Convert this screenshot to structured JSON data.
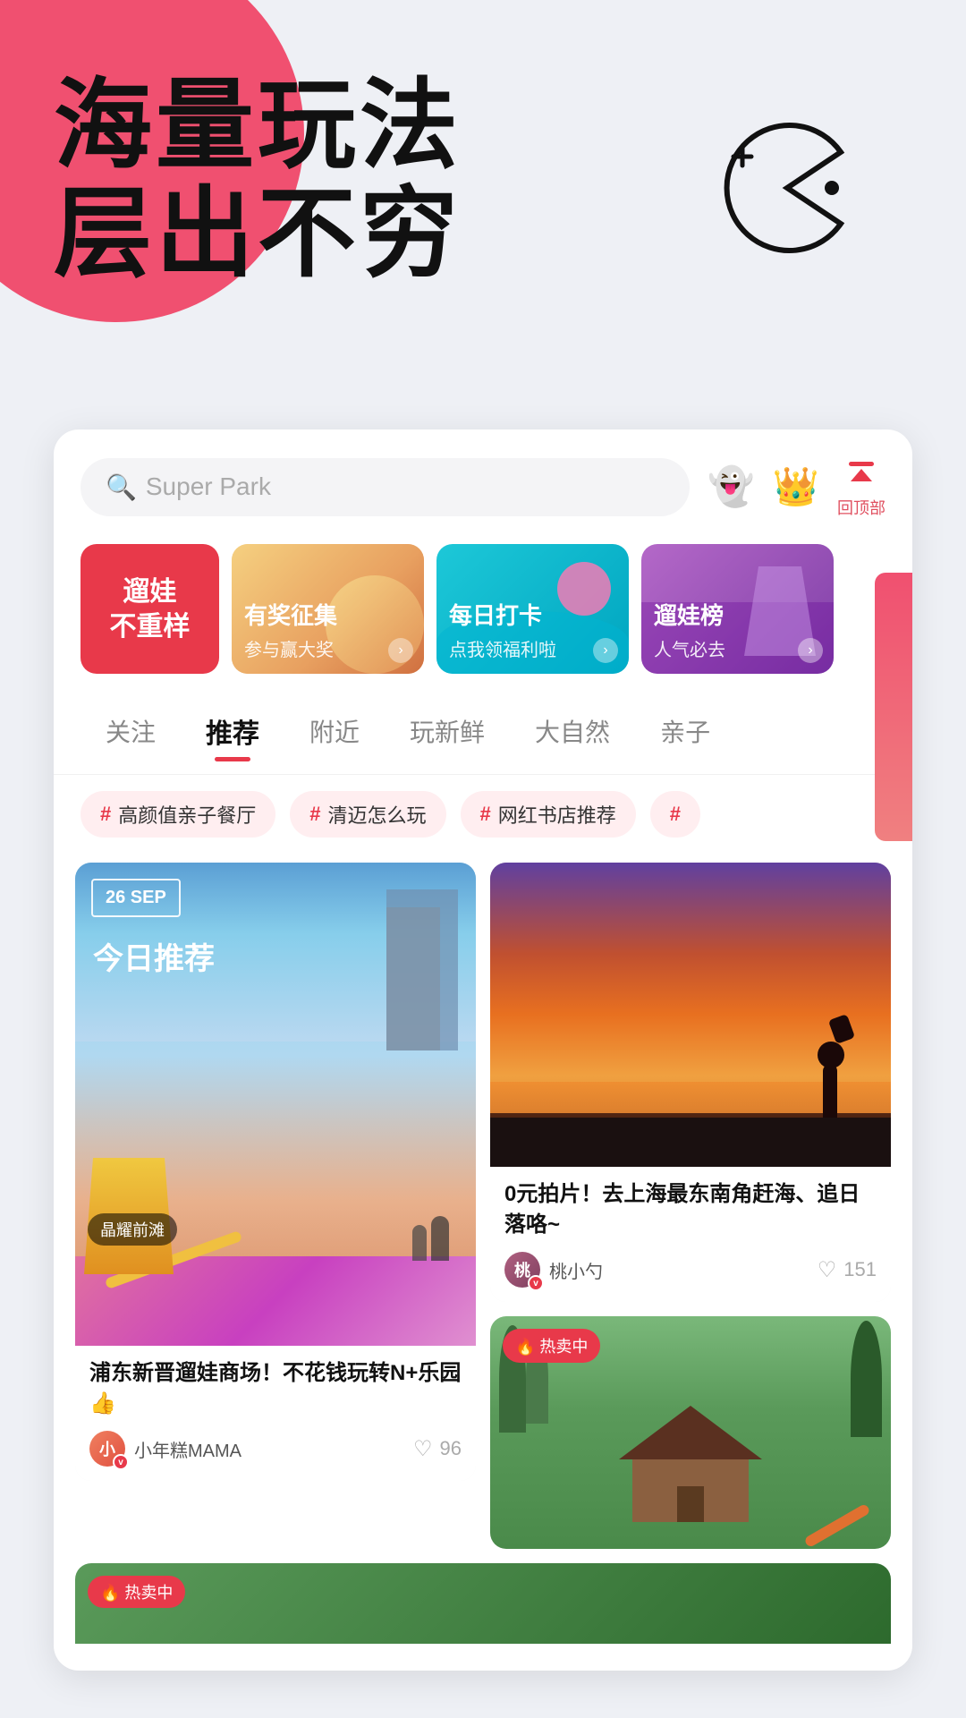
{
  "hero": {
    "line1": "海量玩法",
    "line2": "层出不穷"
  },
  "search": {
    "placeholder": "Super Park",
    "icon": "🔍"
  },
  "icons": [
    {
      "id": "ghost",
      "emoji": "👻",
      "label": ""
    },
    {
      "id": "crown",
      "emoji": "👑",
      "label": ""
    },
    {
      "id": "backtop",
      "label": "回顶部"
    }
  ],
  "banners": [
    {
      "id": "red",
      "text": "遛娃\n不重样",
      "type": "red"
    },
    {
      "id": "photo",
      "title": "有奖征集",
      "subtitle": "参与赢大奖",
      "type": "photo-warm"
    },
    {
      "id": "blue",
      "title": "每日打卡",
      "subtitle": "点我领福利啦",
      "type": "blue"
    },
    {
      "id": "purple",
      "title": "遛娃榜",
      "subtitle": "人气必去",
      "type": "purple"
    }
  ],
  "tabs": [
    {
      "id": "follow",
      "label": "关注",
      "active": false
    },
    {
      "id": "recommend",
      "label": "推荐",
      "active": true
    },
    {
      "id": "nearby",
      "label": "附近",
      "active": false
    },
    {
      "id": "fresh",
      "label": "玩新鲜",
      "active": false
    },
    {
      "id": "nature",
      "label": "大自然",
      "active": false
    },
    {
      "id": "family",
      "label": "亲子",
      "active": false
    }
  ],
  "tags": [
    {
      "id": "t1",
      "text": "高颜值亲子餐厅"
    },
    {
      "id": "t2",
      "text": "清迈怎么玩"
    },
    {
      "id": "t3",
      "text": "网红书店推荐"
    }
  ],
  "cards": {
    "left": {
      "date_month": "26 SEP",
      "today_label": "今日推荐",
      "location": "晶耀前滩",
      "title": "浦东新晋遛娃商场！不花钱玩转N+乐园 👍",
      "author": "小年糕MAMA",
      "likes": "96"
    },
    "right_top": {
      "title": "0元拍片！去上海最东南角赶海、追日落咯~",
      "author": "桃小勺",
      "likes": "151"
    },
    "right_bottom": {
      "hot_badge": "🔥 热卖中"
    }
  },
  "colors": {
    "accent": "#e8394a",
    "blue": "#00b5c8",
    "purple": "#9b59b6"
  }
}
